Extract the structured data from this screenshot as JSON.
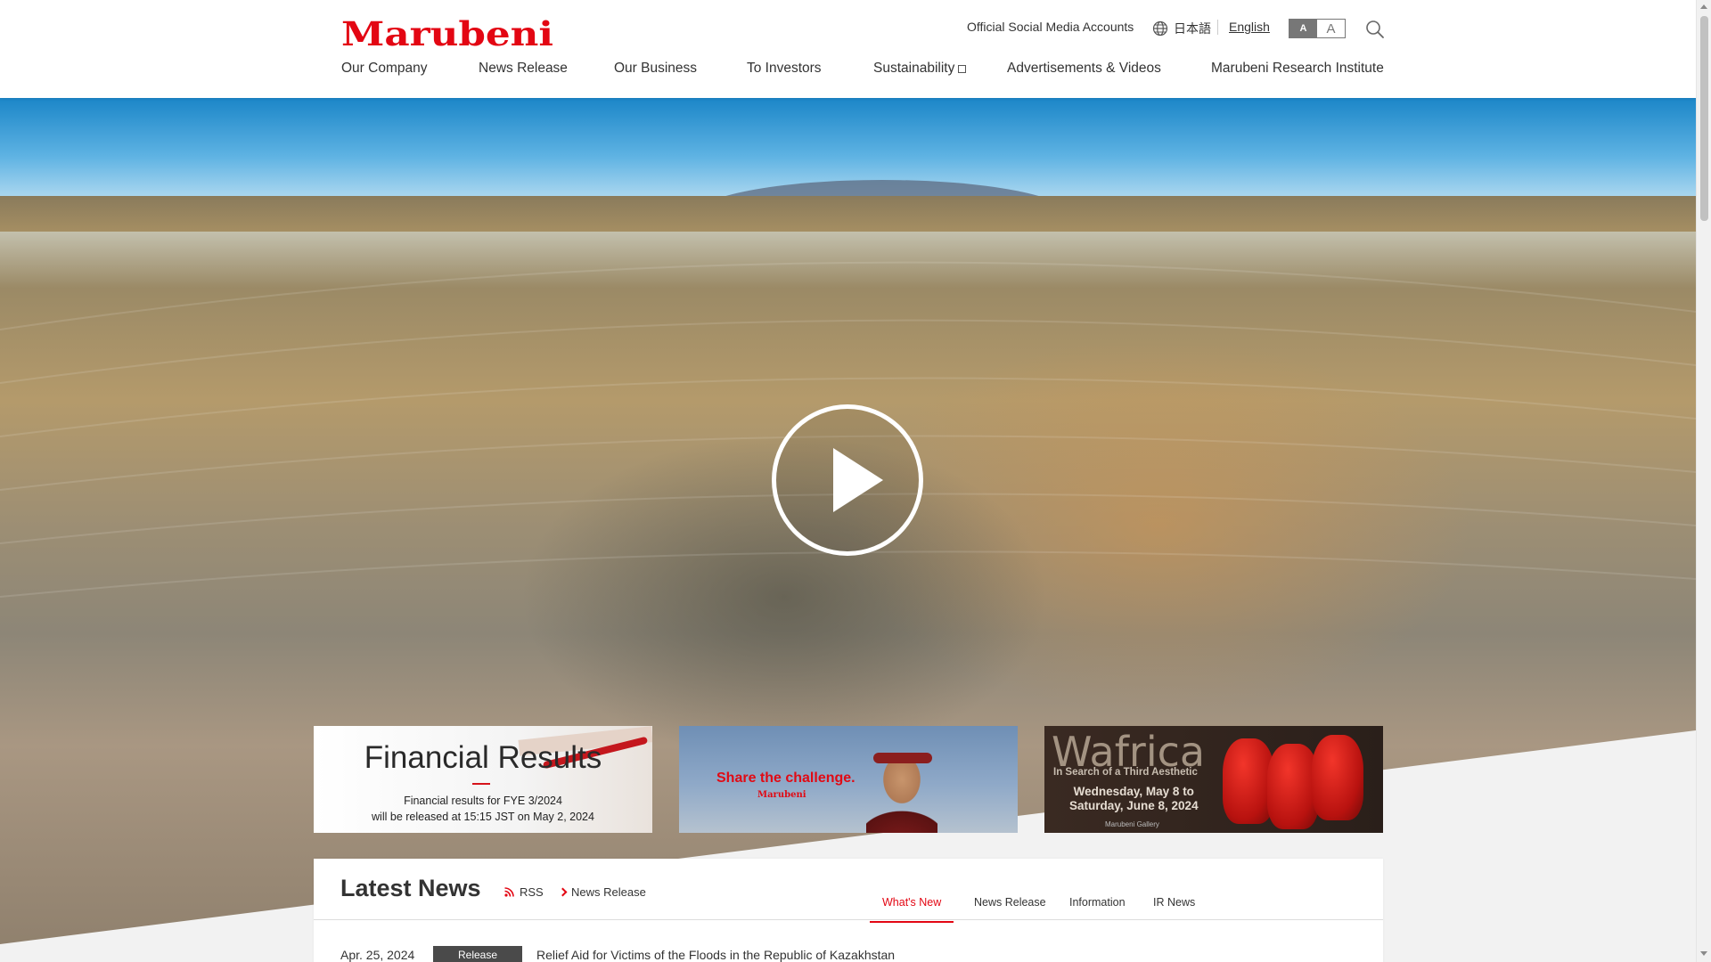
{
  "brand": {
    "logo_text": "Marubeni",
    "accent": "#e30613"
  },
  "utility": {
    "social": "Official Social Media Accounts",
    "language_jp": "日本語",
    "language_en": "English",
    "fontsize_small": "A",
    "fontsize_large": "A",
    "search_icon": "search-icon",
    "globe_icon": "globe-icon"
  },
  "nav": {
    "items": [
      {
        "label": "Our Company"
      },
      {
        "label": "News Release"
      },
      {
        "label": "Our Business"
      },
      {
        "label": "To Investors"
      },
      {
        "label": "Sustainability",
        "external": true
      },
      {
        "label": "Advertisements & Videos"
      },
      {
        "label": "Marubeni Research Institute"
      }
    ]
  },
  "hero": {
    "play_icon": "play-icon"
  },
  "banners": {
    "financial": {
      "title": "Financial Results",
      "line1": "Financial results for FYE 3/2024",
      "line2": "will be released at 15:15 JST on May 2, 2024"
    },
    "share": {
      "headline": "Share the challenge.",
      "logo": "Marubeni"
    },
    "wafrica": {
      "title": "Wafrica",
      "subtitle": "In Search of a Third Aesthetic",
      "dates_line1": "Wednesday, May 8 to",
      "dates_line2": "Saturday, June 8, 2024",
      "gallery": "Marubeni Gallery"
    }
  },
  "news": {
    "title": "Latest News",
    "rss_label": "RSS",
    "release_link": "News Release",
    "tabs": [
      {
        "label": "What's New",
        "active": true
      },
      {
        "label": "News Release",
        "active": false
      },
      {
        "label": "Information",
        "active": false
      },
      {
        "label": "IR News",
        "active": false
      }
    ],
    "items": [
      {
        "date": "Apr. 25, 2024",
        "badge": "Release",
        "text": "Relief Aid for Victims of the Floods in the Republic of Kazakhstan"
      }
    ]
  }
}
